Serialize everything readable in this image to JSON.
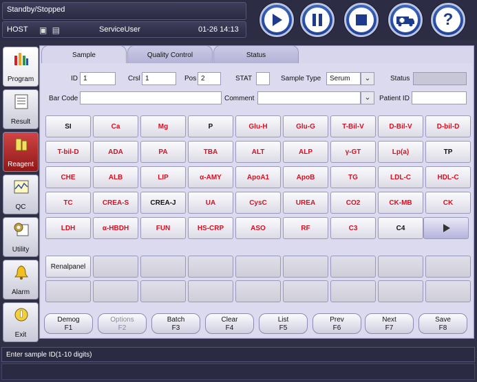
{
  "status_title": "Standby/Stopped",
  "host": {
    "label": "HOST",
    "user": "ServiceUser",
    "datetime": "01-26 14:13"
  },
  "controls": [
    {
      "name": "play",
      "symbol": "▶"
    },
    {
      "name": "pause",
      "symbol": "❚❚"
    },
    {
      "name": "stop",
      "symbol": "■"
    },
    {
      "name": "emergency",
      "symbol": "🚑"
    },
    {
      "name": "help",
      "symbol": "?"
    }
  ],
  "sidebar": [
    {
      "label": "Program",
      "icon": "program-icon"
    },
    {
      "label": "Result",
      "icon": "result-icon"
    },
    {
      "label": "Reagent",
      "icon": "reagent-icon"
    },
    {
      "label": "QC",
      "icon": "qc-icon"
    },
    {
      "label": "Utility",
      "icon": "utility-icon"
    },
    {
      "label": "Alarm",
      "icon": "alarm-icon"
    },
    {
      "label": "Exit",
      "icon": "exit-icon"
    }
  ],
  "tabs": [
    "Sample",
    "Quality Control",
    "Status"
  ],
  "form": {
    "id_label": "ID",
    "id_value": "1",
    "crsl_label": "Crsl",
    "crsl_value": "1",
    "pos_label": "Pos",
    "pos_value": "2",
    "stat_label": "STAT",
    "sample_type_label": "Sample Type",
    "sample_type_value": "Serum",
    "status_label": "Status",
    "status_value": "",
    "barcode_label": "Bar Code",
    "barcode_value": "",
    "comment_label": "Comment",
    "comment_value": "",
    "patient_id_label": "Patient ID",
    "patient_id_value": ""
  },
  "tests": [
    [
      "SI",
      "Ca",
      "Mg",
      "P",
      "Glu-H",
      "Glu-G",
      "T-Bil-V",
      "D-Bil-V",
      "D-bil-D"
    ],
    [
      "T-bil-D",
      "ADA",
      "PA",
      "TBA",
      "ALT",
      "ALP",
      "γ-GT",
      "Lp(a)",
      "TP"
    ],
    [
      "CHE",
      "ALB",
      "LIP",
      "α-AMY",
      "ApoA1",
      "ApoB",
      "TG",
      "LDL-C",
      "HDL-C"
    ],
    [
      "TC",
      "CREA-S",
      "CREA-J",
      "UA",
      "CysC",
      "UREA",
      "CO2",
      "CK-MB",
      "CK"
    ],
    [
      "LDH",
      "α-HBDH",
      "FUN",
      "HS-CRP",
      "ASO",
      "RF",
      "C3",
      "C4",
      ""
    ]
  ],
  "black_tests": [
    "SI",
    "P",
    "TP",
    "CREA-J",
    "C4"
  ],
  "panels": [
    [
      "Renalpanel",
      "",
      "",
      "",
      "",
      "",
      "",
      "",
      ""
    ],
    [
      "",
      "",
      "",
      "",
      "",
      "",
      "",
      "",
      ""
    ]
  ],
  "fkeys": [
    {
      "label": "Demog",
      "key": "F1"
    },
    {
      "label": "Options",
      "key": "F2",
      "disabled": true
    },
    {
      "label": "Batch",
      "key": "F3"
    },
    {
      "label": "Clear",
      "key": "F4"
    },
    {
      "label": "List",
      "key": "F5"
    },
    {
      "label": "Prev",
      "key": "F6"
    },
    {
      "label": "Next",
      "key": "F7"
    },
    {
      "label": "Save",
      "key": "F8"
    }
  ],
  "message": "Enter sample ID(1-10 digits)",
  "colors": {
    "test_red": "#d81020",
    "accent_blue": "#2a4fa8",
    "reagent_red": "#b02020"
  }
}
